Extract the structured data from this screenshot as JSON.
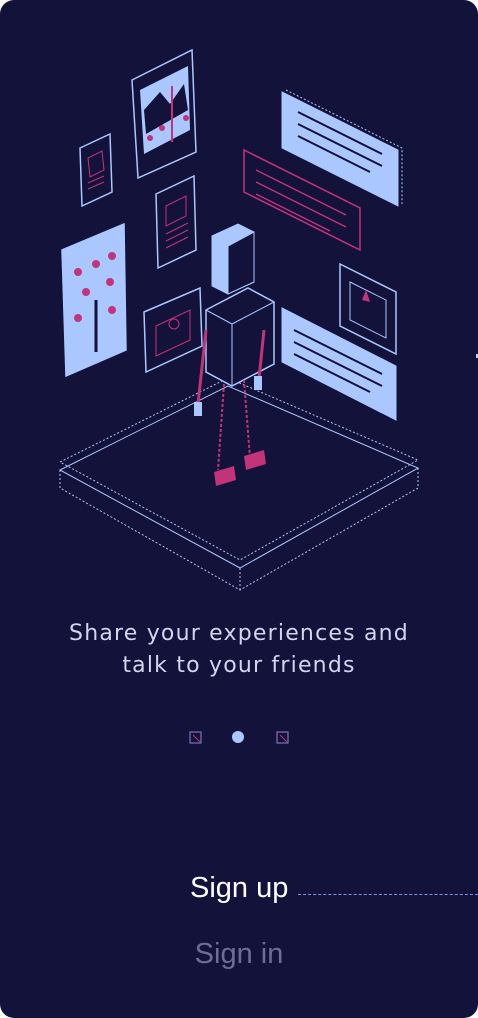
{
  "onboarding": {
    "tagline_line1": "Share your experiences and",
    "tagline_line2": "talk to your friends",
    "pagination": {
      "total": 3,
      "active_index": 1
    },
    "signup_label": "Sign up",
    "signin_label": "Sign in"
  },
  "colors": {
    "background": "#13123a",
    "accent_blue": "#aac8ff",
    "accent_magenta": "#c2337a",
    "text_primary": "#ffffff",
    "text_muted": "#6f6c98"
  }
}
